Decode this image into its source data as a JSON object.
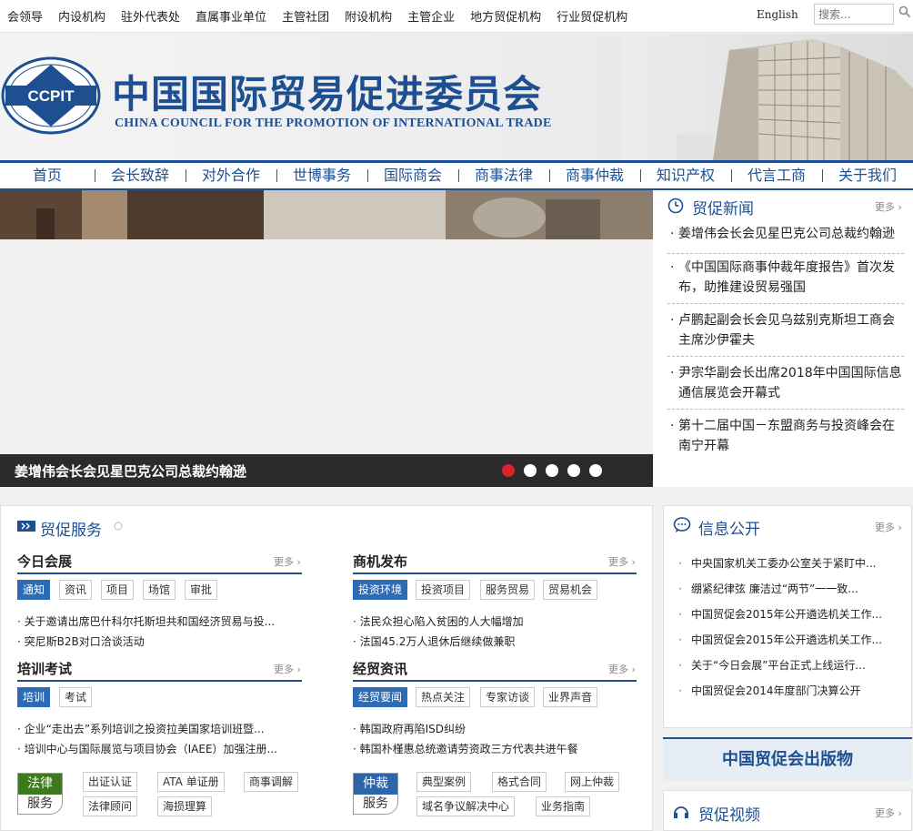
{
  "topbar": {
    "links": [
      "会领导",
      "内设机构",
      "驻外代表处",
      "直属事业单位",
      "主管社团",
      "附设机构",
      "主管企业",
      "地方贸促机构",
      "行业贸促机构"
    ],
    "english": "English",
    "search_placeholder": "搜索..."
  },
  "brand": {
    "logo_text": "CCPIT",
    "name_cn": "中国国际贸易促进委员会",
    "name_en": "CHINA COUNCIL FOR THE PROMOTION OF INTERNATIONAL TRADE"
  },
  "nav": [
    "首页",
    "会长致辞",
    "对外合作",
    "世博事务",
    "国际商会",
    "商事法律",
    "商事仲裁",
    "知识产权",
    "代言工商",
    "关于我们"
  ],
  "slider": {
    "caption": "姜增伟会长会见星巴克公司总裁约翰逊",
    "dot_count": 5,
    "active_dot": 1
  },
  "news": {
    "title": "贸促新闻",
    "more": "更多",
    "items": [
      [
        "姜增伟会长会见星巴克公司总裁约翰逊"
      ],
      [
        "《中国国际商事仲裁年度报告》首次发",
        "布，助推建设贸易强国"
      ],
      [
        "卢鹏起副会长会见乌兹别克斯坦工商会",
        "主席沙伊霍夫"
      ],
      [
        "尹宗华副会长出席2018年中国国际信息",
        "通信展览会开幕式"
      ],
      [
        "第十二届中国－东盟商务与投资峰会在",
        "南宁开幕"
      ]
    ]
  },
  "services": {
    "title": "贸促服务",
    "more": "更多",
    "blocks": {
      "today": {
        "title": "今日会展",
        "tags": [
          "通知",
          "资讯",
          "项目",
          "场馆",
          "审批"
        ],
        "items": [
          "关于邀请出席巴什科尔托斯坦共和国经济贸易与投...",
          "突尼斯B2B对口洽谈活动"
        ]
      },
      "business": {
        "title": "商机发布",
        "tags": [
          "投资环境",
          "投资项目",
          "服务贸易",
          "贸易机会"
        ],
        "items": [
          "法民众担心陷入贫困的人大幅增加",
          "法国45.2万人退休后继续做兼职"
        ]
      },
      "training": {
        "title": "培训考试",
        "tags": [
          "培训",
          "考试"
        ],
        "items": [
          "企业“走出去”系列培训之投资拉美国家培训班暨...",
          "培训中心与国际展览与项目协会（IAEE）加强注册..."
        ]
      },
      "economic": {
        "title": "经贸资讯",
        "tags": [
          "经贸要闻",
          "热点关注",
          "专家访谈",
          "业界声音"
        ],
        "items": [
          "韩国政府再陷ISD纠纷",
          "韩国朴槿惠总统邀请劳资政三方代表共进午餐"
        ]
      }
    },
    "legal": {
      "badge_top": "法律",
      "badge_bottom": "服务",
      "links": [
        "出证认证",
        "ATA 单证册",
        "商事调解",
        "法律顾问",
        "海损理算"
      ]
    },
    "arbitration": {
      "badge_top": "仲裁",
      "badge_bottom": "服务",
      "links": [
        "典型案例",
        "格式合同",
        "网上仲裁",
        "域名争议解决中心",
        "业务指南"
      ]
    }
  },
  "info": {
    "title": "信息公开",
    "more": "更多",
    "items": [
      "中央国家机关工委办公室关于紧盯中...",
      "绷紧纪律弦  廉洁过“两节”一一致...",
      "中国贸促会2015年公开遴选机关工作...",
      "中国贸促会2015年公开遴选机关工作...",
      "关于“今日会展”平台正式上线运行...",
      "中国贸促会2014年度部门决算公开"
    ]
  },
  "publications": "中国贸促会出版物",
  "video": {
    "title": "贸促视频",
    "more": "更多"
  },
  "colors": {
    "brand_blue": "#1d4f91",
    "tag_blue": "#2d6bb5",
    "legal_green": "#3d7a1e",
    "arbitration_blue": "#2e64a8",
    "dot_active": "#d8232a"
  }
}
